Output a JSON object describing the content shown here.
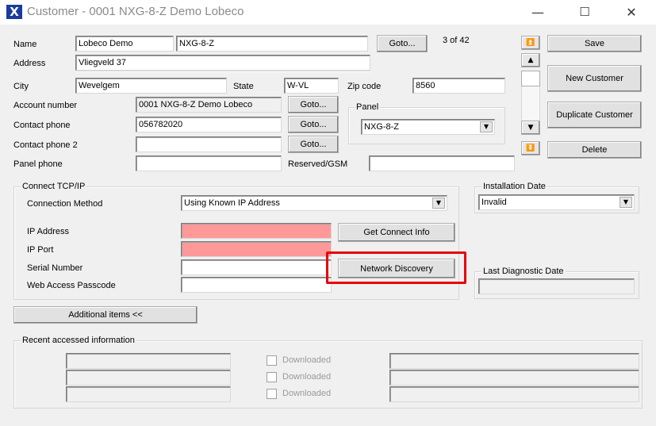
{
  "window": {
    "title": "Customer - 0001 NXG-8-Z Demo Lobeco",
    "icon": "x-app-icon",
    "minimize": "—",
    "maximize": "☐",
    "close": "✕"
  },
  "record": {
    "name_label": "Name",
    "name_value": "Lobeco Demo",
    "name_value2": "NXG-8-Z",
    "goto_label": "Goto...",
    "counter": "3 of 42",
    "address_label": "Address",
    "address_value": "Vliegveld 37",
    "city_label": "City",
    "city_value": "Wevelgem",
    "state_label": "State",
    "state_value": "W-VL",
    "zip_label": "Zip code",
    "zip_value": "8560",
    "account_label": "Account number",
    "account_value": "0001 NXG-8-Z Demo Lobeco",
    "account_goto": "Goto...",
    "contact_label": "Contact phone",
    "contact_value": "056782020",
    "contact_goto": "Goto...",
    "contact2_label": "Contact phone 2",
    "contact2_value": "",
    "contact2_goto": "Goto...",
    "panelphone_label": "Panel phone",
    "panelphone_value": "",
    "reserved_label": "Reserved/GSM",
    "reserved_value": ""
  },
  "panel": {
    "title": "Panel",
    "selected": "NXG-8-Z"
  },
  "actions": {
    "save": "Save",
    "new_customer": "New Customer",
    "duplicate": "Duplicate Customer",
    "delete": "Delete"
  },
  "nav": {
    "first": "⏫",
    "prev": "▲",
    "next": "▼",
    "last": "⏬"
  },
  "connect": {
    "title": "Connect TCP/IP",
    "method_label": "Connection Method",
    "method_value": "Using Known IP Address",
    "ip_label": "IP Address",
    "ip_value": "",
    "port_label": "IP Port",
    "port_value": "",
    "serial_label": "Serial Number",
    "serial_value": "",
    "passcode_label": "Web Access Passcode",
    "passcode_value": "",
    "get_connect_info": "Get Connect Info",
    "network_discovery": "Network Discovery"
  },
  "installation": {
    "title": "Installation Date",
    "value": "Invalid"
  },
  "diagnostic": {
    "title": "Last Diagnostic Date",
    "value": ""
  },
  "additional_items": "Additional items  <<",
  "recent": {
    "title": "Recent accessed information",
    "downloaded_label": "Downloaded",
    "rows": [
      {
        "left": "",
        "right": "",
        "downloaded": false
      },
      {
        "left": "",
        "right": "",
        "downloaded": false
      },
      {
        "left": "",
        "right": "",
        "downloaded": false
      }
    ]
  },
  "colors": {
    "required_field": "#ff9999",
    "highlight_border": "#e8000b",
    "app_icon_bg": "#1a3c9e"
  }
}
